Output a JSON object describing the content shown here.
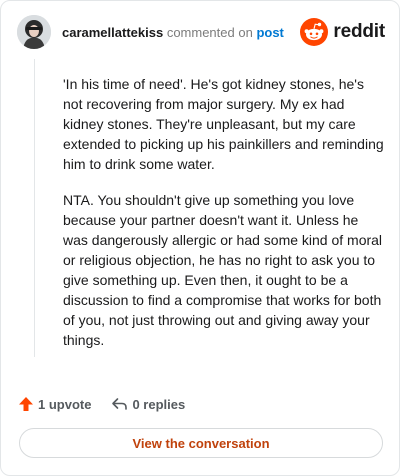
{
  "comment": {
    "username": "caramellattekiss",
    "action_text": "commented on",
    "post_link_text": "post",
    "paragraphs": [
      "'In his time of need'. He's got kidney stones, he's not recovering from major surgery. My ex had kidney stones. They're unpleasant, but my care extended to picking up his painkillers and reminding him to drink some water.",
      "NTA. You shouldn't give up something you love because your partner doesn't want it. Unless he was dangerously allergic or had some kind of moral or religious objection, he has no right to ask you to give something up. Even then, it ought to be a discussion to find a compromise that works for both of you, not just throwing out and giving away your things."
    ]
  },
  "brand": {
    "name": "reddit",
    "icon": "reddit-logo-icon",
    "color": "#ff4500"
  },
  "actions": {
    "upvote_label": "1 upvote",
    "upvote_icon": "upvote-arrow-icon",
    "upvote_color": "#ff4500",
    "replies_label": "0 replies",
    "replies_icon": "reply-arrow-icon"
  },
  "cta": {
    "label": "View the conversation",
    "color": "#c0420c"
  }
}
